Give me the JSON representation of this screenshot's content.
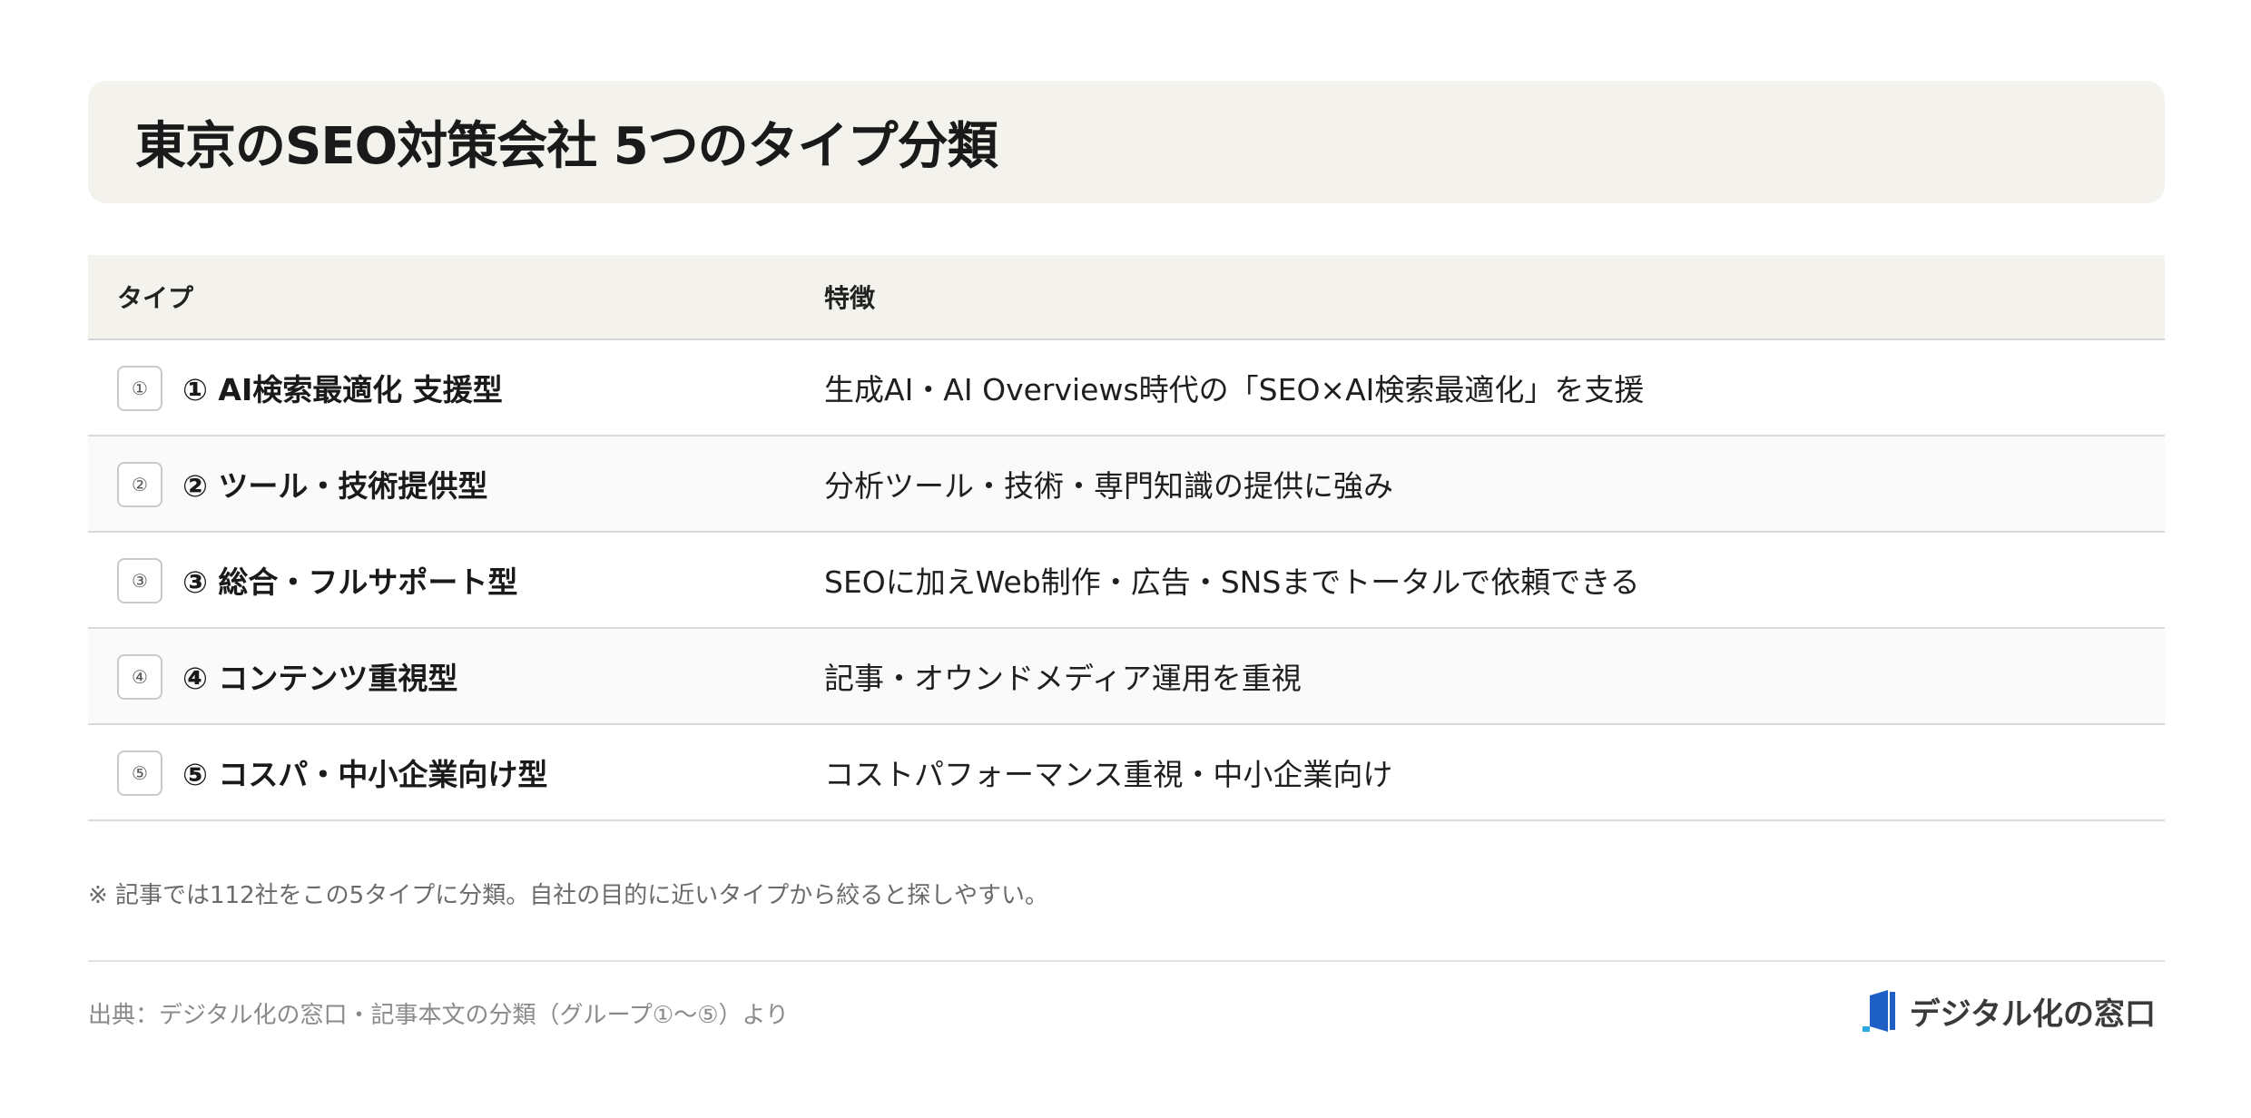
{
  "title": "東京のSEO対策会社 5つのタイプ分類",
  "table": {
    "headers": {
      "type": "タイプ",
      "feature": "特徴"
    },
    "rows": [
      {
        "badge": "①",
        "name": "① AI検索最適化 支援型",
        "feature": "生成AI・AI Overviews時代の「SEO×AI検索最適化」を支援"
      },
      {
        "badge": "②",
        "name": "② ツール・技術提供型",
        "feature": "分析ツール・技術・専門知識の提供に強み"
      },
      {
        "badge": "③",
        "name": "③ 総合・フルサポート型",
        "feature": "SEOに加えWeb制作・広告・SNSまでトータルで依頼できる"
      },
      {
        "badge": "④",
        "name": "④ コンテンツ重視型",
        "feature": "記事・オウンドメディア運用を重視"
      },
      {
        "badge": "⑤",
        "name": "⑤ コスパ・中小企業向け型",
        "feature": "コストパフォーマンス重視・中小企業向け"
      }
    ]
  },
  "note": "※ 記事では112社をこの5タイプに分類。自社の目的に近いタイプから絞ると探しやすい。",
  "source": "出典：デジタル化の窓口・記事本文の分類（グループ①〜⑤）より",
  "brand": {
    "name": "デジタル化の窓口",
    "icon": "window-logo-icon",
    "colors": {
      "primary": "#1d5fc4",
      "accent": "#2aa9e0"
    }
  }
}
